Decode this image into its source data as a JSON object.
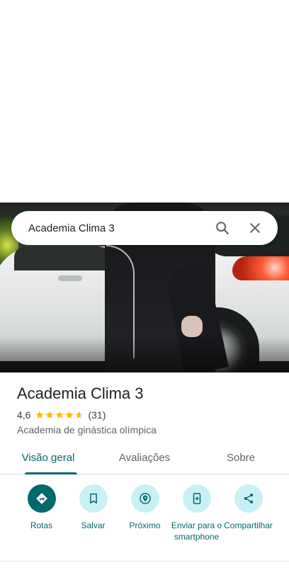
{
  "search": {
    "query": "Academia Clima 3",
    "search_icon": "search-icon",
    "close_icon": "close-icon"
  },
  "place": {
    "name": "Academia Clima 3",
    "rating": "4,6",
    "stars": 4.6,
    "review_count": "(31)",
    "category": "Academia de ginástica olímpica"
  },
  "tabs": [
    {
      "label": "Visão geral",
      "active": true
    },
    {
      "label": "Avaliações",
      "active": false
    },
    {
      "label": "Sobre",
      "active": false
    }
  ],
  "actions": [
    {
      "label": "Rotas",
      "icon": "directions-icon"
    },
    {
      "label": "Salvar",
      "icon": "bookmark-icon"
    },
    {
      "label": "Próximo",
      "icon": "nearby-icon"
    },
    {
      "label": "Enviar para o smartphone",
      "icon": "send-to-phone-icon"
    },
    {
      "label": "Compartilhar",
      "icon": "share-icon"
    }
  ],
  "colors": {
    "accent": "#00696e",
    "action_bg": "#c9f1f5",
    "star": "#fbbc04"
  }
}
